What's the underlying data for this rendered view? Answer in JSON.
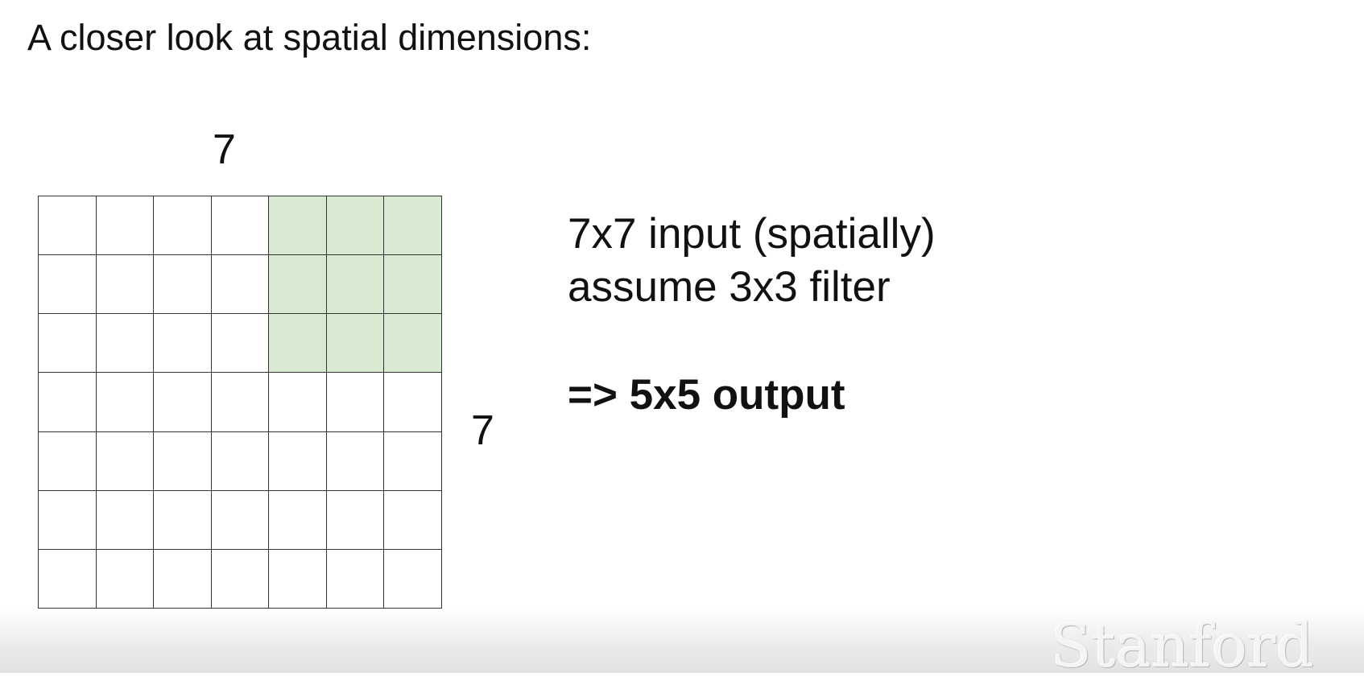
{
  "title": "A closer look at spatial dimensions:",
  "diagram": {
    "grid_rows": 7,
    "grid_cols": 7,
    "top_label": "7",
    "side_label": "7",
    "filter": {
      "row_start": 0,
      "col_start": 4,
      "size": 3
    },
    "cell_color": "#ffffff",
    "filter_color": "#d9ead3",
    "line_color": "#333333"
  },
  "notes": {
    "line1": "7x7 input (spatially)",
    "line2": "assume 3x3 filter",
    "result": "=> 5x5 output"
  },
  "watermark": "Stanford"
}
